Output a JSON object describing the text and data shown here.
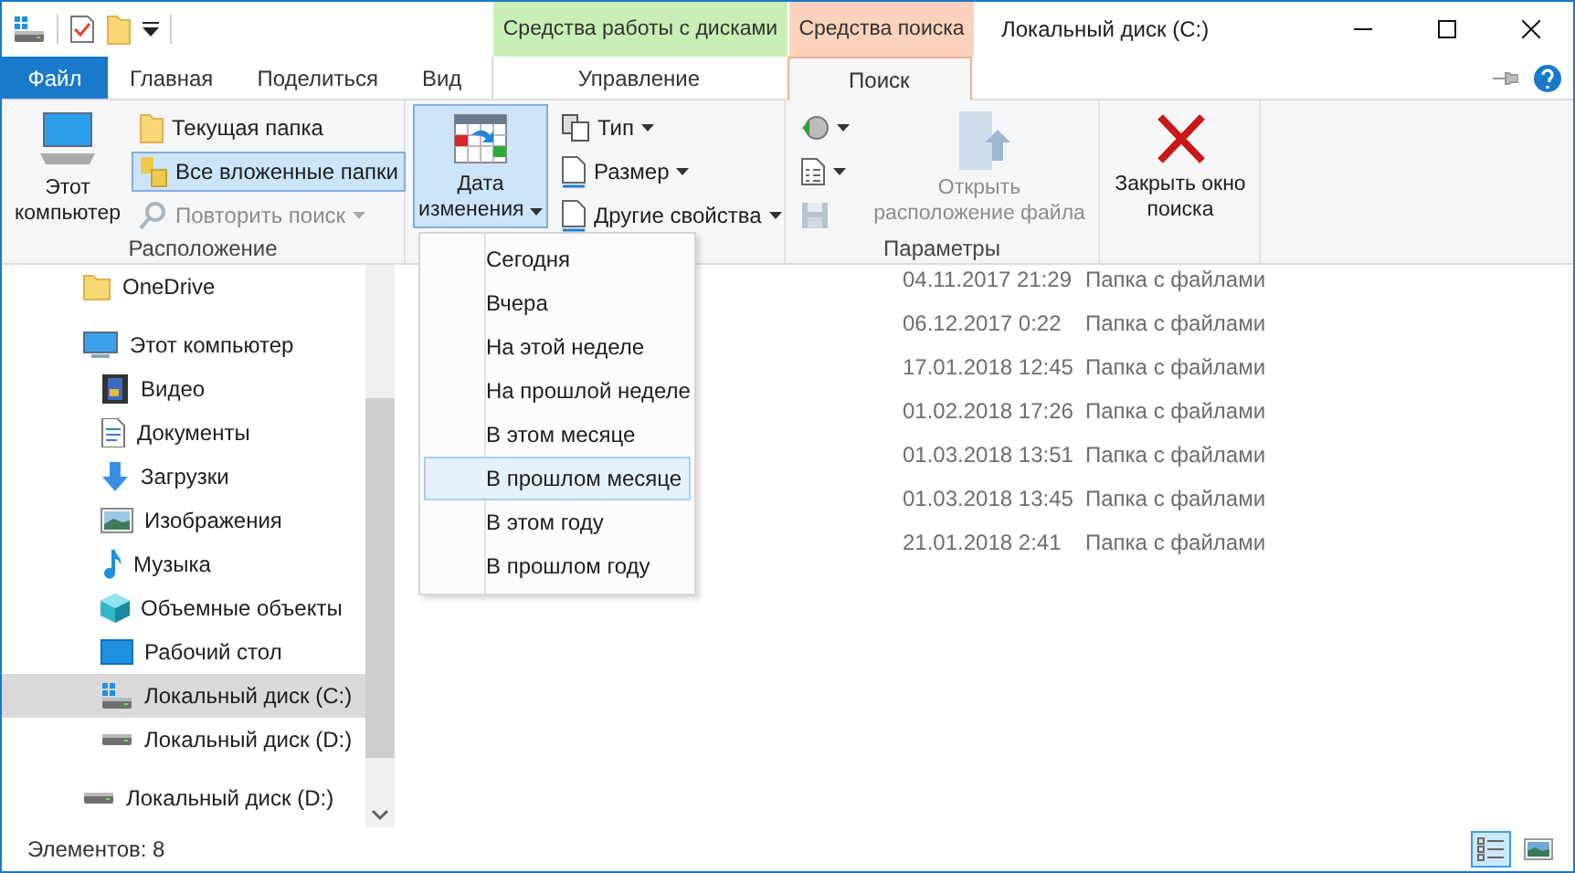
{
  "window": {
    "title": "Локальный диск (C:)"
  },
  "context_tabs": [
    {
      "label": "Средства работы с дисками",
      "color": "#c8eeb4"
    },
    {
      "label": "Средства поиска",
      "color": "#fbd3bc"
    }
  ],
  "tabs": [
    {
      "label": "Файл",
      "kind": "file",
      "selected": false
    },
    {
      "label": "Главная",
      "kind": "normal",
      "selected": false
    },
    {
      "label": "Поделиться",
      "kind": "normal",
      "selected": false
    },
    {
      "label": "Вид",
      "kind": "normal",
      "selected": false
    },
    {
      "label": "Управление",
      "kind": "context",
      "selected": false
    },
    {
      "label": "Поиск",
      "kind": "context",
      "selected": true
    }
  ],
  "ribbon": {
    "groups": [
      {
        "label": "Расположение",
        "big": [
          {
            "label": "Этот компьютер",
            "selected": false,
            "disabled": false
          }
        ],
        "small": [
          {
            "label": "Текущая папка",
            "selected": false,
            "disabled": false
          },
          {
            "label": "Все вложенные папки",
            "selected": true,
            "disabled": false
          },
          {
            "label": "Повторить поиск",
            "selected": false,
            "disabled": true,
            "has_menu": true
          }
        ]
      },
      {
        "big": [
          {
            "label": "Дата изменения",
            "selected": true,
            "disabled": false,
            "has_menu": true
          }
        ],
        "small": [
          {
            "label": "Тип",
            "selected": false,
            "disabled": false,
            "has_menu": true
          },
          {
            "label": "Размер",
            "selected": false,
            "disabled": false,
            "has_menu": true
          },
          {
            "label": "Другие свойства",
            "selected": false,
            "disabled": false,
            "has_menu": true
          }
        ]
      },
      {
        "label": "Параметры",
        "icons": [
          {
            "disabled": false,
            "has_menu": true
          },
          {
            "disabled": false,
            "has_menu": true
          },
          {
            "disabled": true
          }
        ],
        "big": [
          {
            "label": "Открыть расположение файла",
            "selected": false,
            "disabled": true
          }
        ]
      },
      {
        "big": [
          {
            "label": "Закрыть окно поиска",
            "selected": false,
            "disabled": false
          }
        ]
      }
    ]
  },
  "date_menu": [
    {
      "label": "Сегодня",
      "selected": false
    },
    {
      "label": "Вчера",
      "selected": false
    },
    {
      "label": "На этой неделе",
      "selected": false
    },
    {
      "label": "На прошлой неделе",
      "selected": false
    },
    {
      "label": "В этом месяце",
      "selected": false
    },
    {
      "label": "В прошлом месяце",
      "selected": true
    },
    {
      "label": "В этом году",
      "selected": false
    },
    {
      "label": "В прошлом году",
      "selected": false
    }
  ],
  "navigation": [
    {
      "label": "OneDrive",
      "selected": false
    },
    {
      "label": "Этот компьютер",
      "selected": false,
      "children": [
        {
          "label": "Видео",
          "selected": false
        },
        {
          "label": "Документы",
          "selected": false
        },
        {
          "label": "Загрузки",
          "selected": false
        },
        {
          "label": "Изображения",
          "selected": false
        },
        {
          "label": "Музыка",
          "selected": false
        },
        {
          "label": "Объемные объекты",
          "selected": false
        },
        {
          "label": "Рабочий стол",
          "selected": false
        },
        {
          "label": "Локальный диск (C:)",
          "selected": true
        },
        {
          "label": "Локальный диск (D:)",
          "selected": false
        }
      ]
    },
    {
      "label": "Локальный диск (D:)",
      "selected": false
    }
  ],
  "files": [
    {
      "date": "04.11.2017 21:29",
      "type": "Папка с файлами"
    },
    {
      "date": "06.12.2017 0:22",
      "type": "Папка с файлами"
    },
    {
      "date": "17.01.2018 12:45",
      "type": "Папка с файлами"
    },
    {
      "date": "01.02.2018 17:26",
      "type": "Папка с файлами"
    },
    {
      "date": "01.03.2018 13:51",
      "type": "Папка с файлами"
    },
    {
      "date": "01.03.2018 13:45",
      "type": "Папка с файлами"
    },
    {
      "date": "21.01.2018 2:41",
      "type": "Папка с файлами"
    }
  ],
  "status_bar": {
    "text": "Элементов: 8",
    "views": [
      {
        "selected": true
      },
      {
        "selected": false
      }
    ]
  }
}
